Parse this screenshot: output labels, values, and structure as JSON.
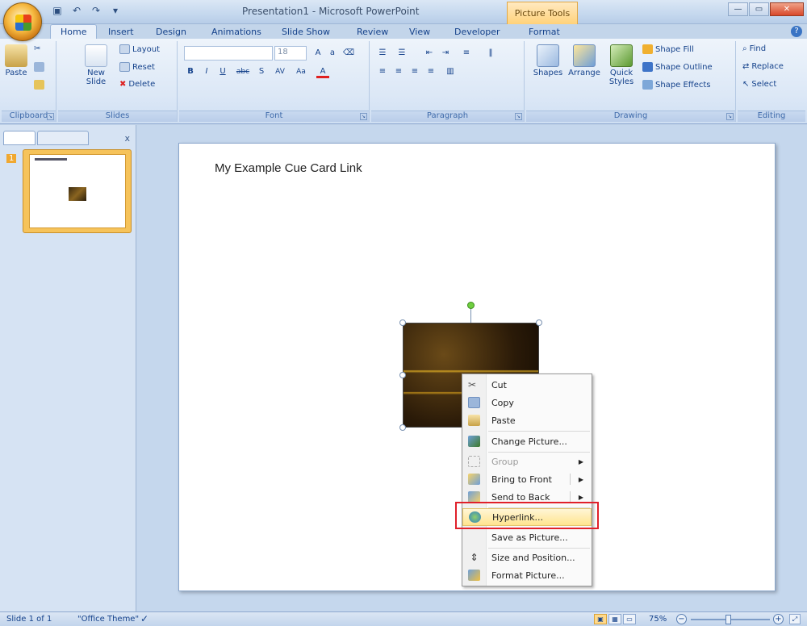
{
  "titlebar": {
    "title": "Presentation1 - Microsoft PowerPoint",
    "contextual_tab": "Picture Tools"
  },
  "tabs": [
    "Home",
    "Insert",
    "Design",
    "Animations",
    "Slide Show",
    "Review",
    "View",
    "Developer",
    "Format"
  ],
  "ribbon": {
    "clipboard": {
      "label": "Clipboard",
      "paste": "Paste"
    },
    "slides": {
      "label": "Slides",
      "new_slide": "New Slide",
      "layout": "Layout",
      "reset": "Reset",
      "delete": "Delete"
    },
    "font": {
      "label": "Font",
      "size": "18"
    },
    "paragraph": {
      "label": "Paragraph"
    },
    "drawing": {
      "label": "Drawing",
      "shapes": "Shapes",
      "arrange": "Arrange",
      "quick_styles": "Quick Styles",
      "shape_fill": "Shape Fill",
      "shape_outline": "Shape Outline",
      "shape_effects": "Shape Effects"
    },
    "editing": {
      "label": "Editing",
      "find": "Find",
      "replace": "Replace",
      "select": "Select"
    }
  },
  "slides_panel": {
    "slide_number": "1"
  },
  "slide": {
    "title": "My Example Cue Card Link"
  },
  "context_menu": {
    "items": [
      {
        "label": "Cut"
      },
      {
        "label": "Copy"
      },
      {
        "label": "Paste"
      },
      {
        "label": "Change Picture..."
      },
      {
        "label": "Group"
      },
      {
        "label": "Bring to Front"
      },
      {
        "label": "Send to Back"
      },
      {
        "label": "Hyperlink..."
      },
      {
        "label": "Save as Picture..."
      },
      {
        "label": "Size and Position..."
      },
      {
        "label": "Format Picture..."
      }
    ],
    "highlighted": "Hyperlink..."
  },
  "statusbar": {
    "slide_info": "Slide 1 of 1",
    "theme": "\"Office Theme\"",
    "zoom": "75%"
  }
}
